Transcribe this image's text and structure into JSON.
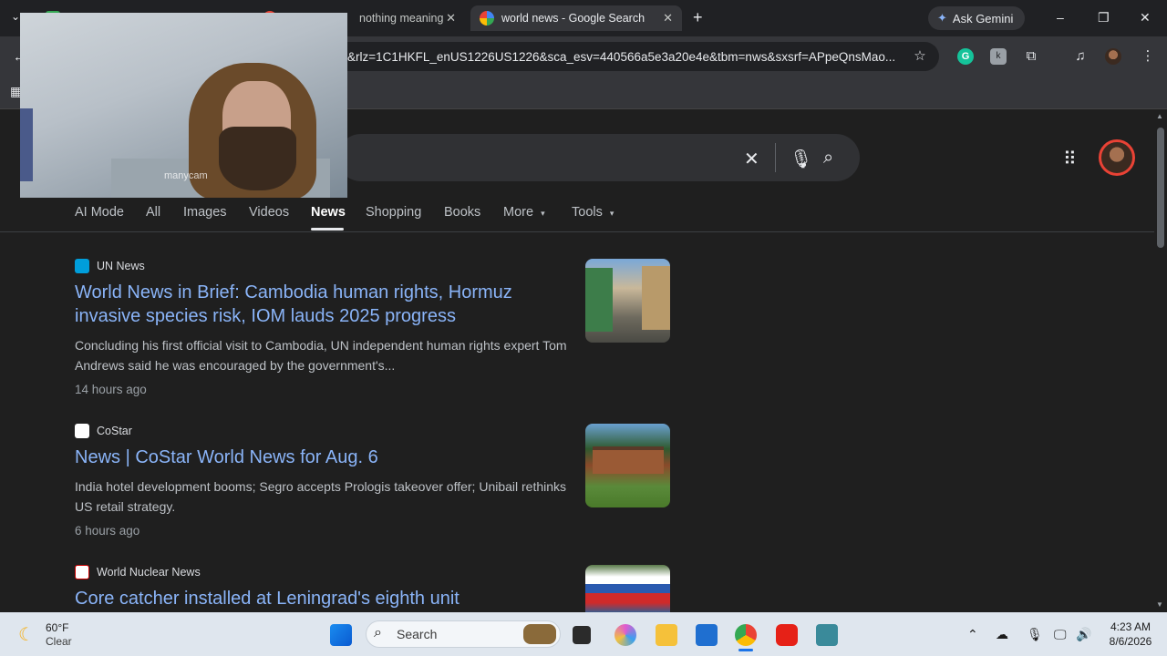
{
  "tabs": [
    {
      "label": "",
      "close": "✕"
    },
    {
      "label": "nothing meaning",
      "close": "✕"
    },
    {
      "label": "world news - Google Search",
      "close": "✕"
    }
  ],
  "new_tab": "+",
  "ask_gemini": "Ask Gemini",
  "window_controls": {
    "minimize": "–",
    "restore": "❐",
    "close": "✕"
  },
  "url": "&rlz=1C1HKFL_enUS1226US1226&sca_esv=440566a5e3a20e4e&tbm=nws&sxsrf=APpeQnsMao...",
  "webcam_watermark": "manycam",
  "search": {
    "clear": "✕"
  },
  "nav_tabs": [
    "AI Mode",
    "All",
    "Images",
    "Videos",
    "News",
    "Shopping",
    "Books",
    "More",
    "Tools"
  ],
  "results": [
    {
      "source": "UN News",
      "headline": "World News in Brief: Cambodia human rights, Hormuz invasive species risk, IOM lauds 2025 progress",
      "snippet": "Concluding his first official visit to Cambodia, UN independent human rights expert Tom Andrews said he was encouraged by the government's...",
      "time": "14 hours ago"
    },
    {
      "source": "CoStar",
      "headline": "News | CoStar World News for Aug. 6",
      "snippet": "India hotel development booms; Segro accepts Prologis takeover offer; Unibail rethinks US retail strategy.",
      "time": "6 hours ago"
    },
    {
      "source": "World Nuclear News",
      "headline": "Core catcher installed at Leningrad's eighth unit",
      "snippet": "",
      "time": ""
    }
  ],
  "taskbar": {
    "weather_temp": "60°F",
    "weather_desc": "Clear",
    "search_label": "Search",
    "time": "4:23 AM",
    "date": "8/6/2026"
  },
  "colors": {
    "link": "#8ab4f8",
    "background": "#1f1f1f",
    "taskbar": "#dfe6ee"
  }
}
